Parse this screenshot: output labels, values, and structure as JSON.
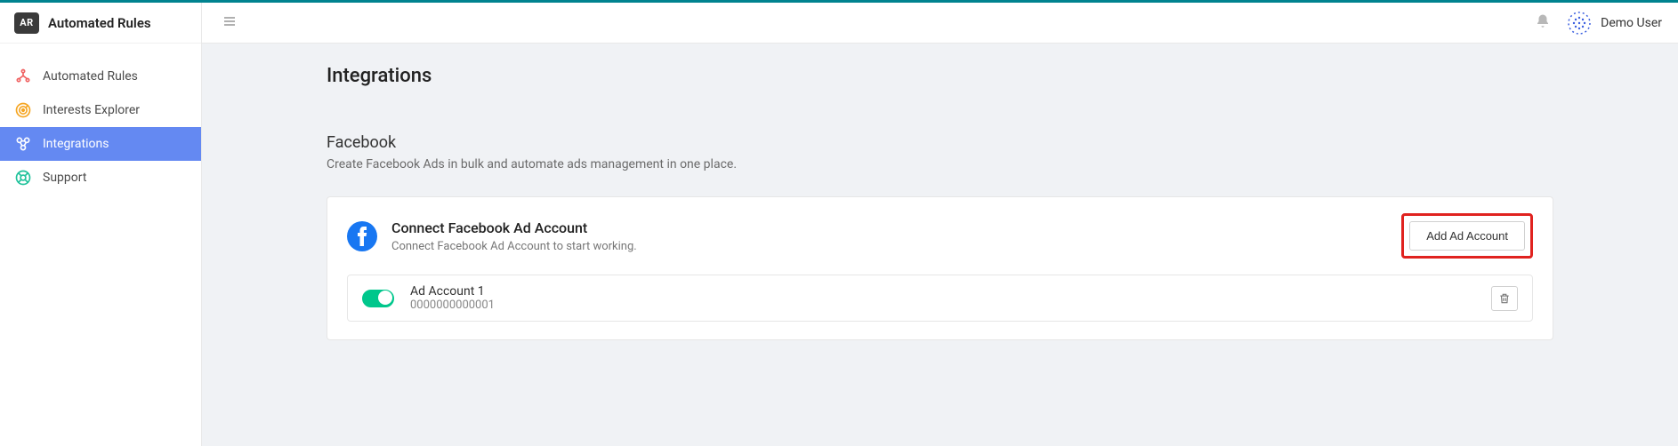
{
  "app": {
    "logo_text": "AR",
    "title": "Automated Rules"
  },
  "sidebar": {
    "items": [
      {
        "label": "Automated Rules",
        "icon": "rules-icon",
        "color": "#f06262"
      },
      {
        "label": "Interests Explorer",
        "icon": "target-icon",
        "color": "#f5a623"
      },
      {
        "label": "Integrations",
        "icon": "integrations-icon",
        "color": "#ffffff",
        "active": true
      },
      {
        "label": "Support",
        "icon": "support-icon",
        "color": "#1fc29b"
      }
    ]
  },
  "header": {
    "user_name": "Demo User"
  },
  "page": {
    "title": "Integrations",
    "section_title": "Facebook",
    "section_desc": "Create Facebook Ads in bulk and automate ads management in one place.",
    "connect_title": "Connect Facebook Ad Account",
    "connect_sub": "Connect Facebook Ad Account to start working.",
    "add_button": "Add Ad Account",
    "accounts": [
      {
        "name": "Ad Account 1",
        "id": "0000000000001",
        "enabled": true
      }
    ]
  }
}
